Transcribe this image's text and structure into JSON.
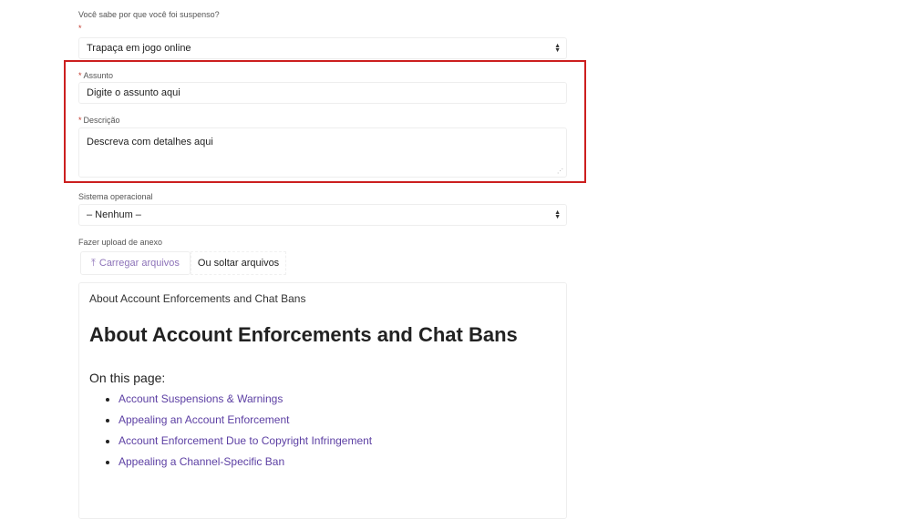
{
  "form": {
    "reason_label": "Você sabe por que você foi suspenso?",
    "required_mark": "*",
    "reason_value": "Trapaça em jogo online",
    "subject_label": "Assunto",
    "subject_value": "Digite o assunto aqui",
    "description_label": "Descrição",
    "description_value": "Descreva com detalhes aqui",
    "os_label": "Sistema operacional",
    "os_value": "– Nenhum –",
    "upload_label": "Fazer upload de anexo",
    "upload_button": "Carregar arquivos",
    "drop_text": "Ou soltar arquivos"
  },
  "article": {
    "breadcrumb": "About Account Enforcements and Chat Bans",
    "title": "About Account Enforcements and Chat Bans",
    "on_this_page": "On this page:",
    "links": [
      "Account Suspensions & Warnings",
      "Appealing an Account Enforcement",
      "Account Enforcement Due to Copyright Infringement",
      "Appealing a Channel-Specific Ban"
    ]
  },
  "colors": {
    "highlight": "#cc1f1f",
    "link": "#5c3fa3"
  }
}
